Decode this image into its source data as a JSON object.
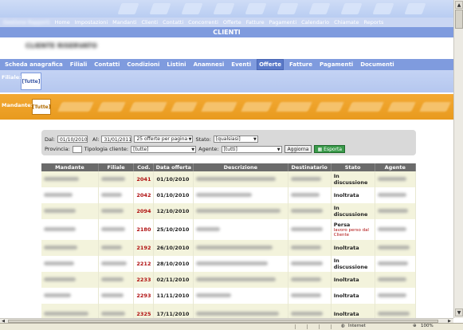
{
  "top_nav": {
    "brand": "Gestione Rapporti",
    "items": [
      "Home",
      "Impostazioni",
      "Mandanti",
      "Clienti",
      "Contatti",
      "Concorrenti",
      "Offerte",
      "Fatture",
      "Pagamenti",
      "Calendario",
      "Chiamate",
      "Reports"
    ]
  },
  "page_title": "CLIENTI",
  "client_name": "CLIENTE RISERVATO",
  "sub_tabs": [
    {
      "label": "Scheda anagrafica",
      "active": false
    },
    {
      "label": "Filiali",
      "active": false
    },
    {
      "label": "Contatti",
      "active": false
    },
    {
      "label": "Condizioni",
      "active": false
    },
    {
      "label": "Listini",
      "active": false
    },
    {
      "label": "Anamnesi",
      "active": false
    },
    {
      "label": "Eventi",
      "active": false
    },
    {
      "label": "Offerte",
      "active": true
    },
    {
      "label": "Fatture",
      "active": false
    },
    {
      "label": "Pagamenti",
      "active": false
    },
    {
      "label": "Documenti",
      "active": false
    }
  ],
  "filiale": {
    "label": "Filiale:",
    "tutte": "[Tutte]"
  },
  "mandante": {
    "label": "Mandante:",
    "tutte": "[Tutte]"
  },
  "filters": {
    "dal_label": "Dal:",
    "dal_value": "01/10/2010",
    "al_label": "Al:",
    "al_value": "31/01/2011",
    "per_page": "25 offerte per pagina",
    "stato_label": "Stato:",
    "stato_value": "[qualsiasi]",
    "provincia_label": "Provincia:",
    "provincia_value": "",
    "tipologia_label": "Tipologia cliente:",
    "tipologia_value": "[tutte]",
    "agente_label": "Agente:",
    "agente_value": "[tutti]",
    "aggiorna": "Aggiorna",
    "esporta": "Esporta"
  },
  "table": {
    "columns": [
      "Mandante",
      "Filiale",
      "Cod.",
      "Data offerta",
      "Descrizione",
      "Destinatario",
      "Stato",
      "Agente"
    ],
    "rows": [
      {
        "cod": "2041",
        "data": "01/10/2010",
        "stato": "In discussione",
        "note": ""
      },
      {
        "cod": "2042",
        "data": "01/10/2010",
        "stato": "Inoltrata",
        "note": ""
      },
      {
        "cod": "2094",
        "data": "12/10/2010",
        "stato": "In discussione",
        "note": ""
      },
      {
        "cod": "2180",
        "data": "25/10/2010",
        "stato": "Persa",
        "note": "lavoro perso dal Cliente"
      },
      {
        "cod": "2192",
        "data": "26/10/2010",
        "stato": "Inoltrata",
        "note": ""
      },
      {
        "cod": "2212",
        "data": "28/10/2010",
        "stato": "In discussione",
        "note": ""
      },
      {
        "cod": "2233",
        "data": "02/11/2010",
        "stato": "Inoltrata",
        "note": ""
      },
      {
        "cod": "2293",
        "data": "11/11/2010",
        "stato": "Inoltrata",
        "note": ""
      },
      {
        "cod": "2325",
        "data": "17/11/2010",
        "stato": "Inoltrata",
        "note": ""
      }
    ]
  },
  "status_bar": {
    "zone": "Internet",
    "zoom": "100%"
  },
  "colors": {
    "nav_blue": "#7f9bde",
    "orange": "#f0a22a",
    "code_red": "#b01010",
    "header_gray": "#6b6b6b",
    "row_tint": "#f3f3dc"
  }
}
